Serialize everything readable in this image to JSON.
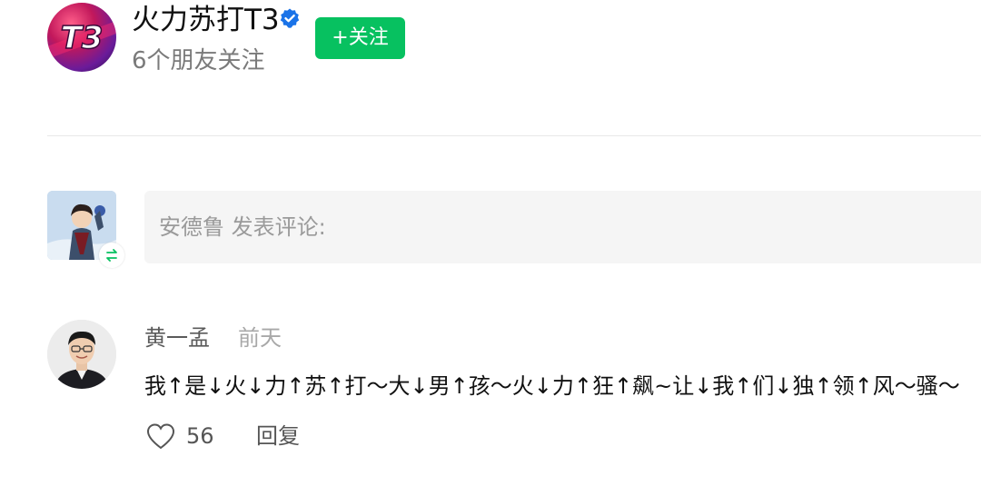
{
  "account": {
    "name": "火力苏打T3",
    "logo_text": "T3",
    "friends_following": "6个朋友关注",
    "follow_label": "+关注"
  },
  "comment_box": {
    "placeholder": "安德鲁 发表评论:"
  },
  "comment": {
    "author": "黄一孟",
    "time": "前天",
    "text": "我↑是↓火↓力↑苏↑打～大↓男↑孩～火↓力↑狂↑飙~让↓我↑们↓独↑领↑风～骚～",
    "likes": "56",
    "reply_label": "回复"
  },
  "colors": {
    "follow_button": "#07c160",
    "verified": "#1a73e8",
    "switch_badge": "#07c160"
  }
}
